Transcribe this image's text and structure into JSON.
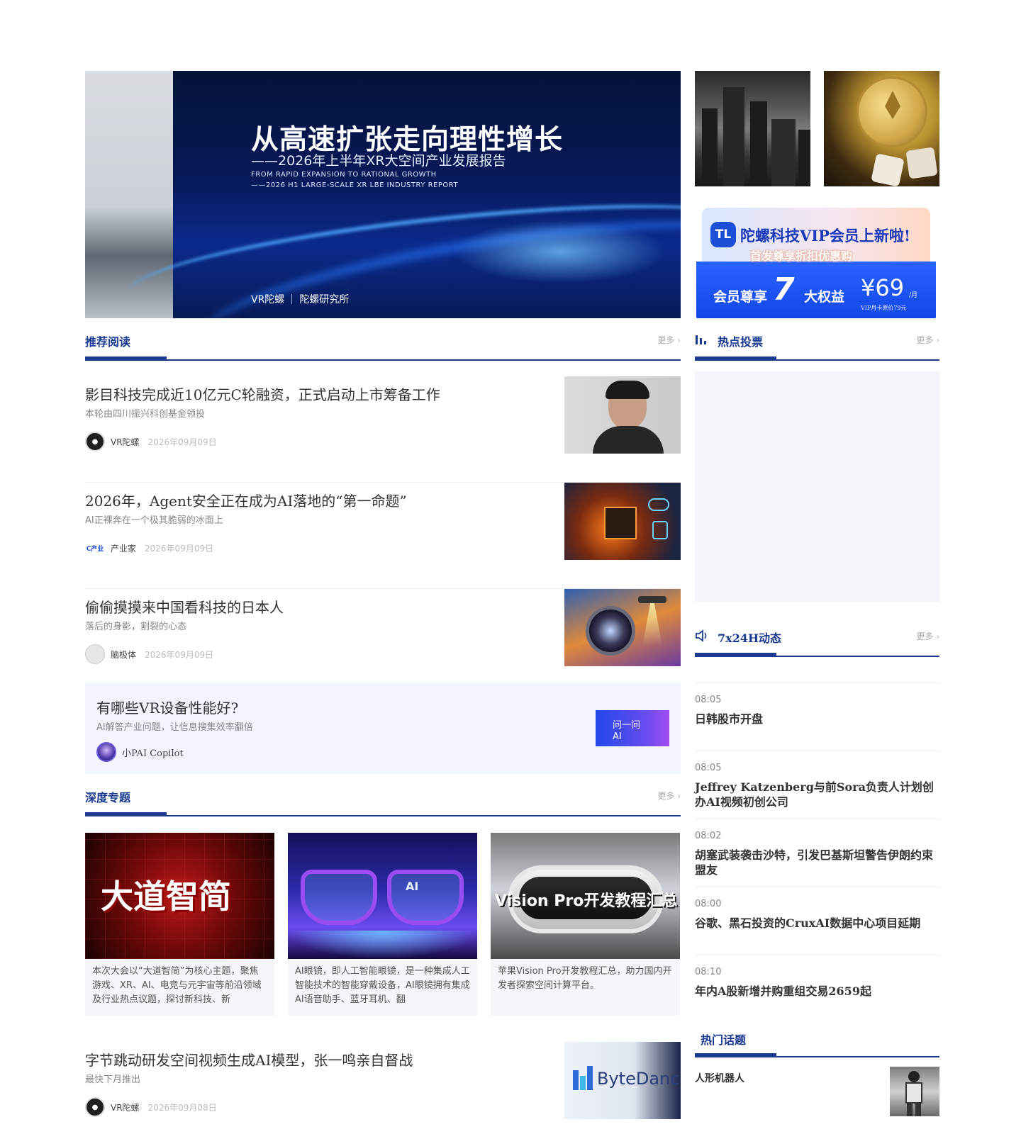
{
  "banner": {
    "title": "从高速扩张走向理性增长",
    "subtitle": "——2026年上半年XR大空间产业发展报告",
    "en_line1": "FROM RAPID EXPANSION TO RATIONAL GROWTH",
    "en_line2": "——2026 H1 LARGE-SCALE XR LBE INDUSTRY REPORT",
    "logo_left": "VR陀螺",
    "logo_right": "陀螺研究所"
  },
  "vip_ad": {
    "logo": "TL",
    "title": "陀螺科技VIP会员上新啦!",
    "subtitle": "首发尊享折扣优惠购",
    "left_text": "会员尊享",
    "number": "7",
    "right_text": "大权益",
    "price": "¥69",
    "unit": "/月",
    "note": "VIP月卡原价79元"
  },
  "sections": {
    "recommended": {
      "title": "推荐阅读",
      "more": "更多 ›"
    },
    "hot_vote": {
      "title": "热点投票",
      "more": "更多 ›"
    },
    "news_7x24": {
      "title": "7x24H动态",
      "more": "更多 ›"
    },
    "deep_topics": {
      "title": "深度专题",
      "more": "更多 ›"
    },
    "hot_topics": {
      "title": "热门话题"
    }
  },
  "articles": [
    {
      "title": "影目科技完成近10亿元C轮融资，正式启动上市筹备工作",
      "subtitle": "本轮由四川振兴科创基金领投",
      "author": "VR陀螺",
      "date": "2026年09月09日"
    },
    {
      "title": "2026年，Agent安全正在成为AI落地的“第一命题”",
      "subtitle": "AI正裸奔在一个极其脆弱的冰面上",
      "author": "产业家",
      "date": "2026年09月09日"
    },
    {
      "title": "偷偷摸摸来中国看科技的日本人",
      "subtitle": "落后的身影，割裂的心态",
      "author": "脑极体",
      "date": "2026年09月09日"
    }
  ],
  "ai_box": {
    "title": "有哪些VR设备性能好?",
    "subtitle": "AI解答产业问题，让信息搜集效率翻倍",
    "author": "小PAI Copilot",
    "button_line1": "问一问",
    "button_line2": "AI"
  },
  "topics": [
    {
      "image_text": "大道智简",
      "desc": "本次大会以“大道智简”为核心主题，聚焦游戏、XR、AI、电竞与元宇宙等前沿领域及行业热点议题，探讨新科技、新"
    },
    {
      "image_text": "AI",
      "desc": "AI眼镜，即人工智能眼镜，是一种集成人工智能技术的智能穿戴设备，AI眼镜拥有集成AI语音助手、蓝牙耳机、翻"
    },
    {
      "image_text": "Vision Pro开发教程汇总",
      "desc": "苹果Vision Pro开发教程汇总，助力国内开发者探索空间计算平台。"
    }
  ],
  "bottom_article": {
    "title": "字节跳动研发空间视频生成AI模型，张一鸣亲自督战",
    "subtitle": "最快下月推出",
    "author": "VR陀螺",
    "date": "2026年09月08日",
    "image_text": "ByteDance"
  },
  "news": [
    {
      "time": "08:05",
      "title": "日韩股市开盘"
    },
    {
      "time": "08:05",
      "title": "Jeffrey Katzenberg与前Sora负责人计划创办AI视频初创公司"
    },
    {
      "time": "08:02",
      "title": "胡塞武装袭击沙特，引发巴基斯坦警告伊朗约束盟友"
    },
    {
      "time": "08:00",
      "title": "谷歌、黑石投资的CruxAI数据中心项目延期"
    },
    {
      "time": "08:10",
      "title": "年内A股新增并购重组交易2659起"
    }
  ],
  "hot_topic_item": {
    "title": "人形机器人"
  },
  "colors": {
    "brand": "#1a3a8f",
    "accent": "#2147e8",
    "muted": "#888888"
  }
}
